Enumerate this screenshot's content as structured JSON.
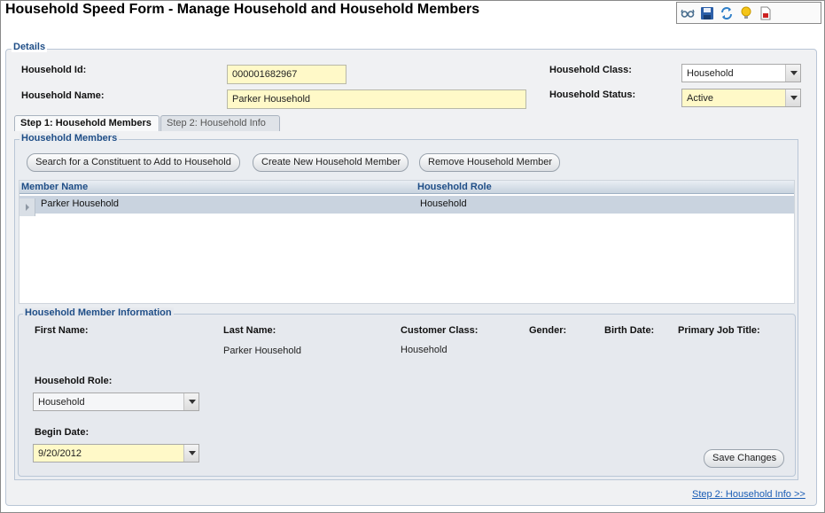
{
  "page": {
    "title": "Household Speed Form - Manage Household and Household Members"
  },
  "toolbar": {
    "buttons": [
      {
        "icon": "glasses-icon"
      },
      {
        "icon": "save-icon"
      },
      {
        "icon": "refresh-icon"
      },
      {
        "icon": "lightbulb-icon"
      },
      {
        "icon": "pdf-icon"
      }
    ]
  },
  "details": {
    "legend": "Details",
    "household_id_label": "Household Id:",
    "household_id_value": "000001682967",
    "household_name_label": "Household Name:",
    "household_name_value": "Parker Household",
    "household_class_label": "Household Class:",
    "household_class_value": "Household",
    "household_status_label": "Household Status:",
    "household_status_value": "Active"
  },
  "tabs": [
    {
      "label": "Step 1: Household Members",
      "active": true
    },
    {
      "label": "Step 2: Household Info",
      "active": false
    }
  ],
  "members": {
    "legend": "Household Members",
    "buttons": {
      "search": "Search for a Constituent to Add to Household",
      "create": "Create New Household Member",
      "remove": "Remove Household Member"
    },
    "columns": [
      "Member Name",
      "Household Role"
    ],
    "rows": [
      {
        "member_name": "Parker Household",
        "role": "Household"
      }
    ]
  },
  "member_info": {
    "legend": "Household Member Information",
    "first_name_label": "First Name:",
    "last_name_label": "Last Name:",
    "last_name_value": "Parker Household",
    "customer_class_label": "Customer Class:",
    "customer_class_value": "Household",
    "gender_label": "Gender:",
    "birth_date_label": "Birth Date:",
    "job_title_label": "Primary Job Title:",
    "household_role_label": "Household Role:",
    "household_role_value": "Household",
    "begin_date_label": "Begin Date:",
    "begin_date_value": "9/20/2012",
    "save_label": "Save Changes"
  },
  "footer": {
    "next_link": "Step 2: Household Info >>"
  },
  "colors": {
    "accent": "#1f4e87",
    "required_field": "#fff9c8",
    "link": "#1a5db5",
    "selected_row": "#c9d3df"
  }
}
